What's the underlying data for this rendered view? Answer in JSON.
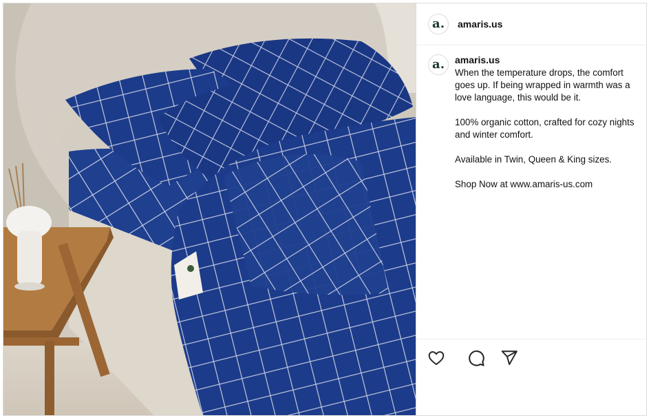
{
  "post": {
    "username": "amaris.us",
    "avatar_letter": "a.",
    "caption_paragraphs": [
      "When the temperature drops, the comfort goes up. If being wrapped in warmth was a love language, this would be it.",
      "100% organic cotton, crafted for cozy nights and winter comfort.",
      "Available in Twin, Queen & King sizes.",
      "Shop Now at www.amaris-us.com"
    ]
  },
  "actions": [
    {
      "name": "like-button",
      "icon": "heart-icon"
    },
    {
      "name": "comment-button",
      "icon": "comment-icon"
    },
    {
      "name": "share-button",
      "icon": "send-icon"
    }
  ],
  "colors": {
    "sheet_navy": "#1c3b8a",
    "headboard": "#d8d3cb",
    "table_wood": "#a8733d",
    "border": "#dbdbdb"
  }
}
